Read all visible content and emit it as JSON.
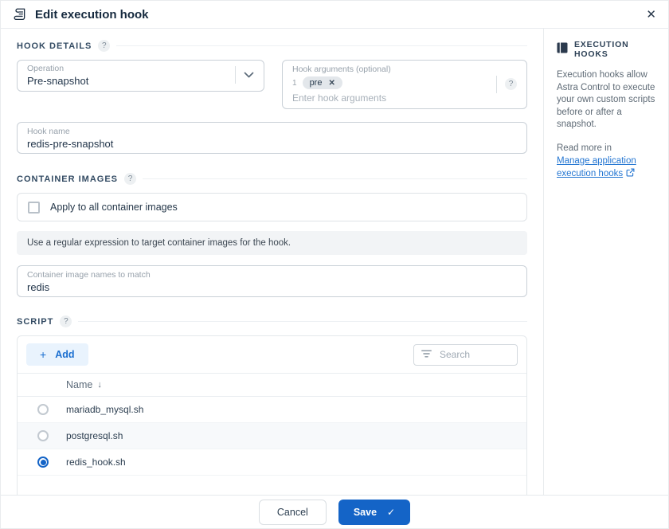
{
  "header": {
    "title": "Edit execution hook"
  },
  "icons": {
    "close": "✕",
    "help": "?",
    "plus": "+",
    "check": "✓",
    "sort_desc": "↓",
    "chip_remove": "✕"
  },
  "hook_details": {
    "section_title": "HOOK DETAILS",
    "operation": {
      "label": "Operation",
      "value": "Pre-snapshot"
    },
    "hook_arguments": {
      "label": "Hook arguments (optional)",
      "index": "1",
      "chip": "pre",
      "placeholder": "Enter hook arguments"
    },
    "hook_name": {
      "label": "Hook name",
      "value": "redis-pre-snapshot"
    }
  },
  "container_images": {
    "section_title": "CONTAINER IMAGES",
    "apply_all_label": "Apply to all container images",
    "info_text": "Use a regular expression to target container images for the hook.",
    "match_field": {
      "label": "Container image names to match",
      "value": "redis"
    }
  },
  "script": {
    "section_title": "SCRIPT",
    "add_label": "Add",
    "search_placeholder": "Search",
    "column_header": "Name",
    "rows": [
      {
        "name": "mariadb_mysql.sh",
        "selected": false
      },
      {
        "name": "postgresql.sh",
        "selected": false
      },
      {
        "name": "redis_hook.sh",
        "selected": true
      }
    ]
  },
  "sidebar": {
    "title": "EXECUTION HOOKS",
    "description": "Execution hooks allow Astra Control to execute your own custom scripts before or after a snapshot.",
    "read_more_prefix": "Read more in",
    "link_text": "Manage application execution hooks"
  },
  "footer": {
    "cancel_label": "Cancel",
    "save_label": "Save"
  },
  "colors": {
    "accent_blue": "#1464c7",
    "link_blue": "#2476d2",
    "add_bg": "#e9f3fd"
  }
}
